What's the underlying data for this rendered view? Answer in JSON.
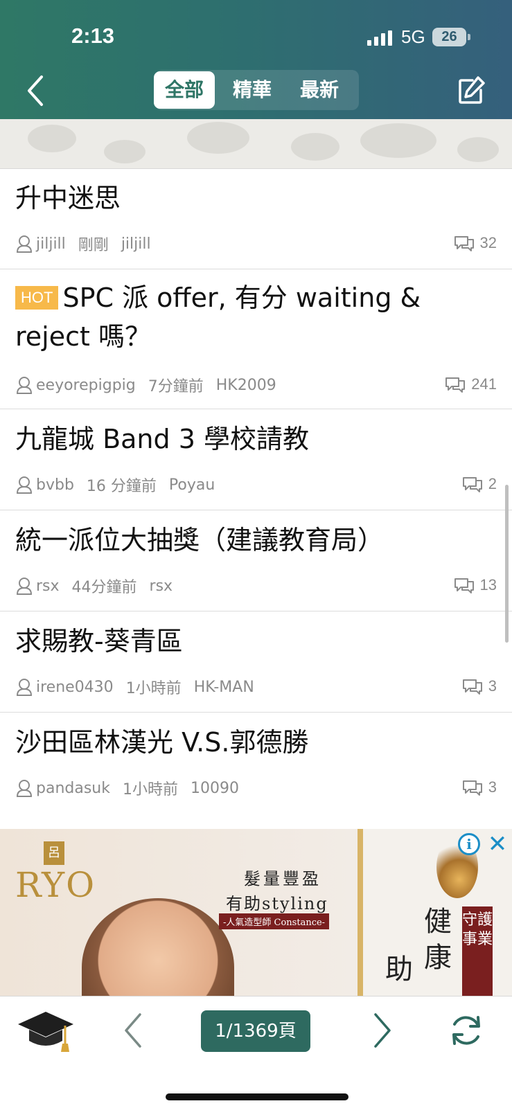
{
  "status_bar": {
    "time": "2:13",
    "network": "5G",
    "battery": "26"
  },
  "header": {
    "tabs": [
      {
        "label": "全部",
        "active": true
      },
      {
        "label": "精華",
        "active": false
      },
      {
        "label": "最新",
        "active": false
      }
    ],
    "accent_color": "#2f7666"
  },
  "threads": [
    {
      "title": "升中迷思",
      "hot": false,
      "author": "jiljill",
      "time": "剛剛",
      "last_reply": "jiljill",
      "replies": "32"
    },
    {
      "title": "SPC 派 offer, 有分 waiting & reject 嗎？",
      "hot": true,
      "hot_label": "HOT",
      "author": "eeyorepigpig",
      "time": "7分鐘前",
      "last_reply": "HK2009",
      "replies": "241"
    },
    {
      "title": "九龍城 Band 3 學校請教",
      "hot": false,
      "author": "bvbb",
      "time": "16 分鐘前",
      "last_reply": "Poyau",
      "replies": "2"
    },
    {
      "title": "統一派位大抽獎（建議教育局）",
      "hot": false,
      "author": "rsx",
      "time": "44分鐘前",
      "last_reply": "rsx",
      "replies": "13"
    },
    {
      "title": "求賜教-葵青區",
      "hot": false,
      "author": "irene0430",
      "time": "1小時前",
      "last_reply": "HK-MAN",
      "replies": "3"
    },
    {
      "title": "沙田區林漢光 V.S.郭德勝",
      "hot": false,
      "author": "pandasuk",
      "time": "1小時前",
      "last_reply": "10090",
      "replies": "3"
    }
  ],
  "ad": {
    "brand_mark": "呂",
    "brand": "RYO",
    "line1": "髮量豐盈",
    "line2": "有助styling",
    "line3": "-人氣造型師 Constance-",
    "big_text": "健康",
    "help_text": "助",
    "vertical_text": "守護事業",
    "info_label": "i",
    "close_label": "✕"
  },
  "bottom_bar": {
    "pager": "1/1369頁"
  }
}
